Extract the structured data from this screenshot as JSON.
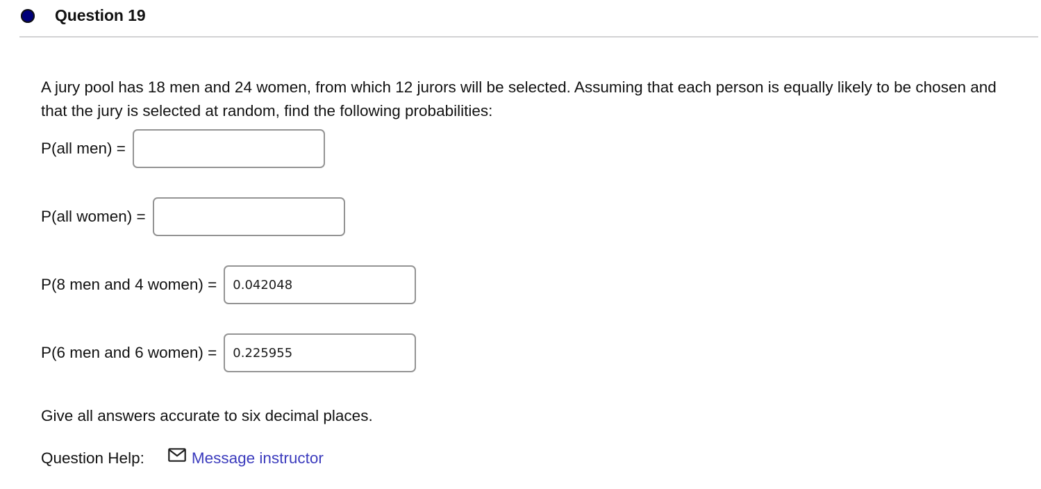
{
  "header": {
    "bullet_color": "#00007a",
    "title": "Question 19"
  },
  "question": {
    "prompt": "A jury pool has 18 men and 24 women, from which 12 jurors will be selected. Assuming that each person is equally likely to be chosen and that the jury is selected at random, find the following probabilities:"
  },
  "answers": [
    {
      "label": "P(all men) =",
      "value": "",
      "placeholder": ""
    },
    {
      "label": "P(all women) =",
      "value": "",
      "placeholder": ""
    },
    {
      "label": "P(8 men and 4 women) =",
      "value": "0.042048",
      "placeholder": ""
    },
    {
      "label": "P(6 men and 6 women) =",
      "value": "0.225955",
      "placeholder": ""
    }
  ],
  "note": "Give all answers accurate to six decimal places.",
  "help": {
    "label": "Question Help:",
    "icon": "envelope-icon",
    "link_text": "Message instructor",
    "link_color": "#3b3bbd"
  }
}
